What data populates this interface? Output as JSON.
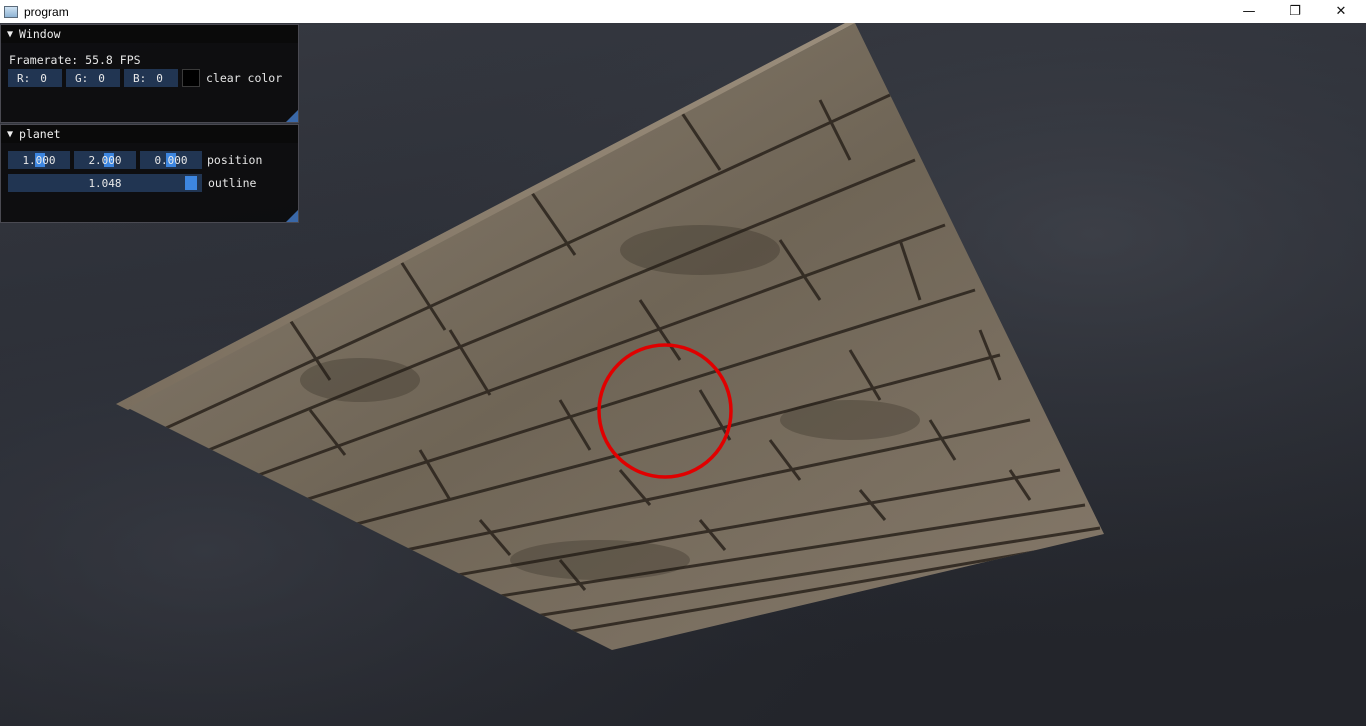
{
  "titlebar": {
    "title": "program",
    "minimize": "—",
    "maximize": "❐",
    "close": "✕"
  },
  "window_panel": {
    "title": "Window",
    "framerate": "Framerate: 55.8 FPS",
    "r_label": "R:",
    "r_value": "0",
    "g_label": "G:",
    "g_value": "0",
    "b_label": "B:",
    "b_value": "0",
    "clear_color_label": "clear color",
    "clear_color": "#000000"
  },
  "planet_panel": {
    "title": "planet",
    "pos_x": "1.000",
    "pos_y": "2.000",
    "pos_z": "0.000",
    "position_label": "position",
    "outline_value": "1.048",
    "outline_label": "outline"
  },
  "colors": {
    "accent": "#3d86e0",
    "field_bg": "#213552",
    "highlight_circle": "#e00000"
  }
}
